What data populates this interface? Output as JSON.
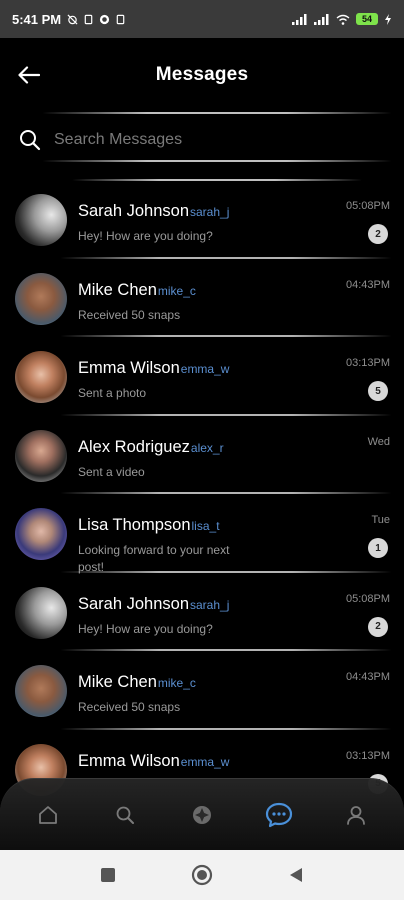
{
  "status_bar": {
    "time": "5:41 PM",
    "battery": "54"
  },
  "header": {
    "title": "Messages"
  },
  "search": {
    "placeholder": "Search Messages",
    "value": ""
  },
  "conversations": [
    {
      "name": "Sarah Johnson",
      "handle": "sarah_j",
      "message": "Hey! How are you doing?",
      "time": "05:08PM",
      "unread": "2",
      "avatar": "gradient-placeholder"
    },
    {
      "name": "Mike Chen",
      "handle": "mike_c",
      "message": "Received 50 snaps",
      "time": "04:43PM",
      "unread": "",
      "avatar": "photo-man-smiling"
    },
    {
      "name": "Emma Wilson",
      "handle": "emma_w",
      "message": "Sent a photo",
      "time": "03:13PM",
      "unread": "5",
      "avatar": "photo-woman-redhair"
    },
    {
      "name": "Alex Rodriguez",
      "handle": "alex_r",
      "message": "Sent a video",
      "time": "Wed",
      "unread": "",
      "avatar": "photo-man-bald"
    },
    {
      "name": "Lisa Thompson",
      "handle": "lisa_t",
      "message": "Looking forward to your next post!",
      "time": "Tue",
      "unread": "1",
      "avatar": "photo-woman-purple"
    },
    {
      "name": "Sarah Johnson",
      "handle": "sarah_j",
      "message": "Hey! How are you doing?",
      "time": "05:08PM",
      "unread": "2",
      "avatar": "gradient-placeholder"
    },
    {
      "name": "Mike Chen",
      "handle": "mike_c",
      "message": "Received 50 snaps",
      "time": "04:43PM",
      "unread": "",
      "avatar": "photo-man-smiling"
    },
    {
      "name": "Emma Wilson",
      "handle": "emma_w",
      "message": "",
      "time": "03:13PM",
      "unread": "5",
      "avatar": "photo-woman-redhair"
    }
  ],
  "bottom_nav": {
    "items": [
      {
        "icon": "home-icon",
        "active": false
      },
      {
        "icon": "search-icon",
        "active": false
      },
      {
        "icon": "aperture-icon",
        "active": false
      },
      {
        "icon": "chat-icon",
        "active": true
      },
      {
        "icon": "profile-icon",
        "active": false
      }
    ],
    "active_color": "#4a90d9",
    "inactive_color": "#7a7a7a"
  },
  "colors": {
    "handle": "#5b8fd0",
    "background": "#000000",
    "statusbar": "#3a3a3a"
  }
}
